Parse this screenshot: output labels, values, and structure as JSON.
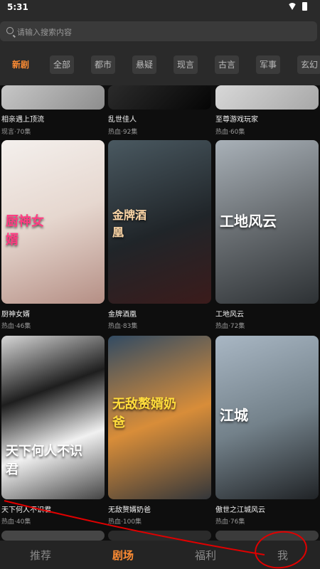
{
  "status": {
    "time": "5:31"
  },
  "search": {
    "placeholder": "请输入搜索内容"
  },
  "tabs": [
    "新剧",
    "全部",
    "都市",
    "悬疑",
    "现言",
    "古言",
    "军事",
    "玄幻"
  ],
  "active_tab": "新剧",
  "cards": [
    {
      "title": "相亲遇上顶流",
      "meta": "现言·70集",
      "poster_text": ""
    },
    {
      "title": "乱世佳人",
      "meta": "热血·92集",
      "poster_text": ""
    },
    {
      "title": "至尊游戏玩家",
      "meta": "热血·60集",
      "poster_text": ""
    },
    {
      "title": "厨神女婿",
      "meta": "热血·46集",
      "poster_text": "厨神女婿"
    },
    {
      "title": "金牌酒凰",
      "meta": "热血·83集",
      "poster_text": "金牌酒凰"
    },
    {
      "title": "工地风云",
      "meta": "热血·72集",
      "poster_text": "工地风云"
    },
    {
      "title": "天下何人不识君",
      "meta": "热血·40集",
      "poster_text": "天下何人不识君"
    },
    {
      "title": "无敌赘婿奶爸",
      "meta": "热血·100集",
      "poster_text": "无敌赘婿奶爸"
    },
    {
      "title": "傲世之江城风云",
      "meta": "热血·76集",
      "poster_text": "江城"
    }
  ],
  "bottom_nav": [
    "推荐",
    "剧场",
    "福利",
    "我"
  ],
  "active_nav": "剧场",
  "colors": {
    "accent": "#ff8c33",
    "annotation": "#e00000"
  }
}
